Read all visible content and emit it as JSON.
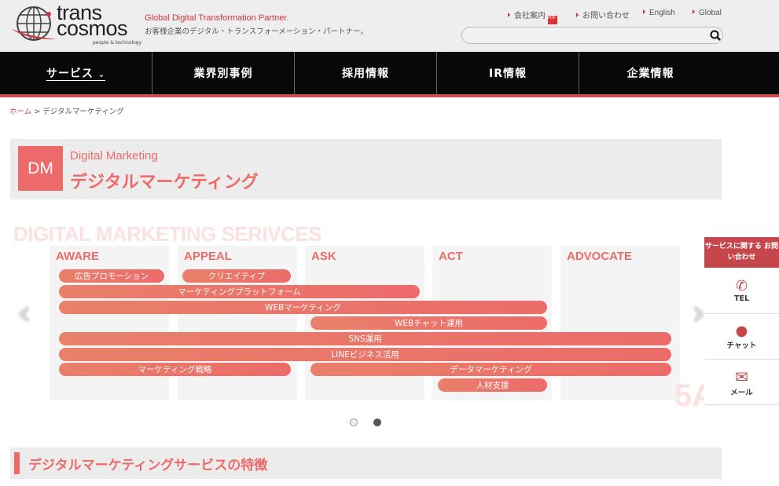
{
  "header": {
    "logo_line1": "trans",
    "logo_line2": "cosmos",
    "logo_sub": "people & technology",
    "tagline_en": "Global Digital Transformation Partner.",
    "tagline_ja": "お客様企業のデジタル・トランスフォーメーション・パートナー。",
    "links": [
      "会社案内",
      "お問い合わせ",
      "English",
      "Global"
    ],
    "search_placeholder": ""
  },
  "nav": {
    "items": [
      "サービス",
      "業界別事例",
      "採用情報",
      "IR情報",
      "企業情報"
    ]
  },
  "breadcrumb": {
    "home": "ホーム",
    "sep": ">",
    "current": "デジタルマーケティング"
  },
  "hero": {
    "badge": "DM",
    "subtitle": "Digital Marketing",
    "title": "デジタルマーケティング"
  },
  "services": {
    "title": "DIGITAL MARKETING SERIVCES",
    "columns": [
      "AWARE",
      "APPEAL",
      "ASK",
      "ACT",
      "ADVOCATE"
    ],
    "bars": [
      "広告プロモーション",
      "クリエイティブ",
      "マーケティングプラットフォーム",
      "WEBマーケティング",
      "WEBチャット運用",
      "SNS運用",
      "LINEビジネス活用",
      "マーケティング戦略",
      "データマーケティング",
      "人材支援"
    ],
    "watermark": "5A",
    "active_slide": 2,
    "slide_count": 2
  },
  "side": {
    "header": "サービスに関する お問い合わせ",
    "tel": "TEL",
    "chat": "チャット",
    "mail": "メール"
  },
  "feature": {
    "title": "デジタルマーケティングサービスの特徴"
  },
  "colors": {
    "accent": "#ec6b6a",
    "nav": "#080808",
    "red": "#d0494d"
  }
}
